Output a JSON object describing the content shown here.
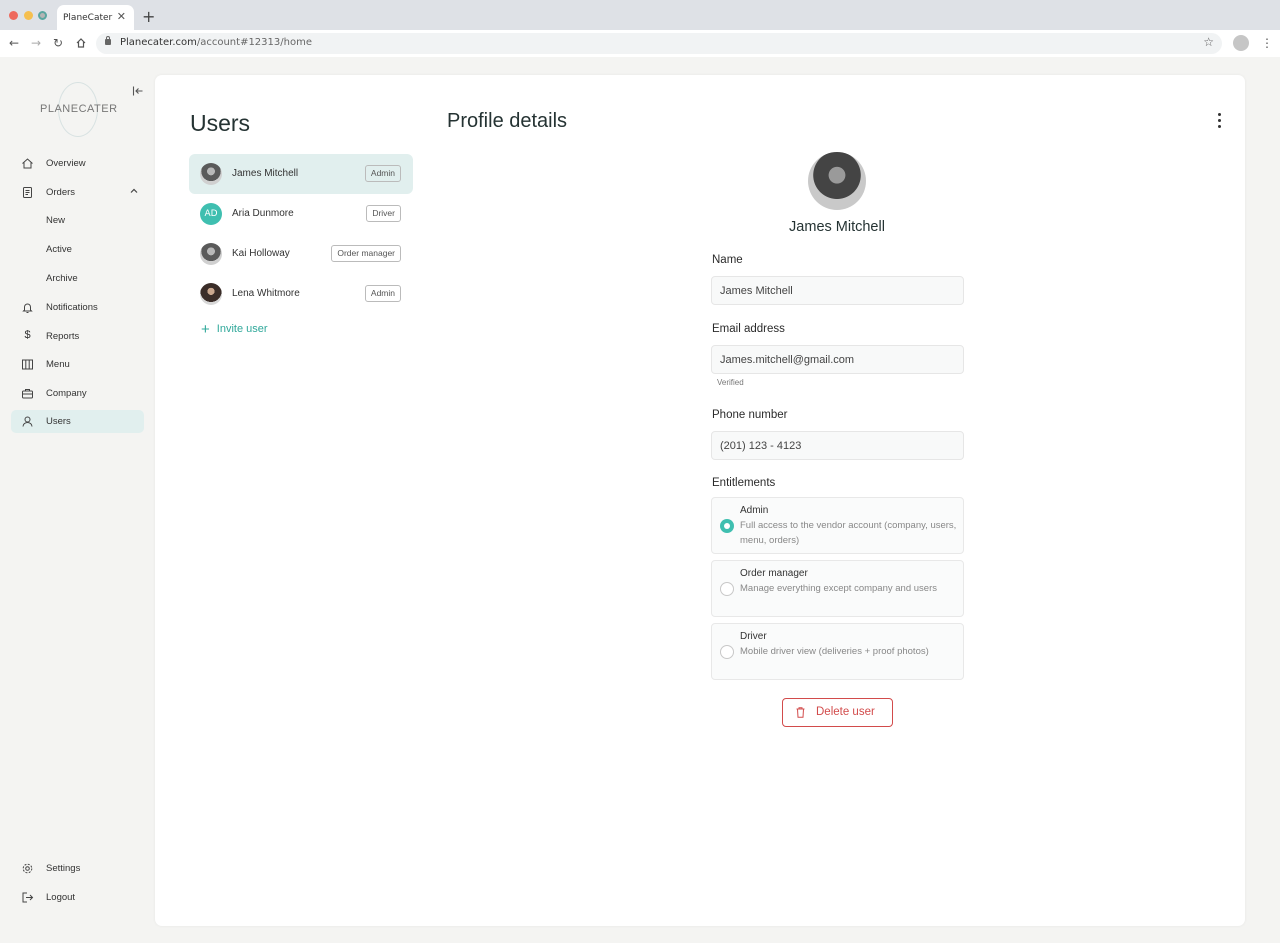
{
  "browser": {
    "tab_title": "PlaneCater",
    "tab_close": "✕",
    "new_tab": "+",
    "url_host": "Planecater.com",
    "url_path": "/account#12313/home"
  },
  "sidebar": {
    "logo_text": "PLANECATER",
    "items": [
      {
        "label": "Overview",
        "icon": "home-icon"
      },
      {
        "label": "Orders",
        "icon": "document-icon"
      },
      {
        "label": "New"
      },
      {
        "label": "Active"
      },
      {
        "label": "Archive"
      },
      {
        "label": "Notifications",
        "icon": "bell-icon"
      },
      {
        "label": "Reports",
        "icon": "dollar-icon"
      },
      {
        "label": "Menu",
        "icon": "columns-icon"
      },
      {
        "label": "Company",
        "icon": "briefcase-icon"
      },
      {
        "label": "Users",
        "icon": "user-icon"
      },
      {
        "label": "Settings",
        "icon": "gear-icon"
      },
      {
        "label": "Logout",
        "icon": "logout-icon"
      }
    ]
  },
  "users_panel": {
    "title": "Users",
    "users": [
      {
        "name": "James Mitchell",
        "role": "Admin",
        "avatar": "photo"
      },
      {
        "name": "Aria Dunmore",
        "role": "Driver",
        "avatar": "AD"
      },
      {
        "name": "Kai Holloway",
        "role": "Order manager",
        "avatar": "photo"
      },
      {
        "name": "Lena Whitmore",
        "role": "Admin",
        "avatar": "photo"
      }
    ],
    "invite_label": "Invite user"
  },
  "profile": {
    "title": "Profile details",
    "name": "James Mitchell",
    "name_label": "Name",
    "name_value": "James Mitchell",
    "email_label": "Email address",
    "email_value": "James.mitchell@gmail.com",
    "email_status": "Verified",
    "phone_label": "Phone number",
    "phone_value": "(201) 123 - 4123",
    "entitlements_label": "Entitlements",
    "entitlements": [
      {
        "title": "Admin",
        "desc": "Full access to the vendor account (company, users, menu, orders)",
        "checked": true
      },
      {
        "title": "Order manager",
        "desc": "Manage everything except company and users",
        "checked": false
      },
      {
        "title": "Driver",
        "desc": "Mobile driver view (deliveries + proof photos)",
        "checked": false
      }
    ],
    "delete_label": "Delete user"
  },
  "colors": {
    "accent": "#3fbfb0",
    "danger": "#d24b4b",
    "selected_bg": "#e1efee"
  }
}
